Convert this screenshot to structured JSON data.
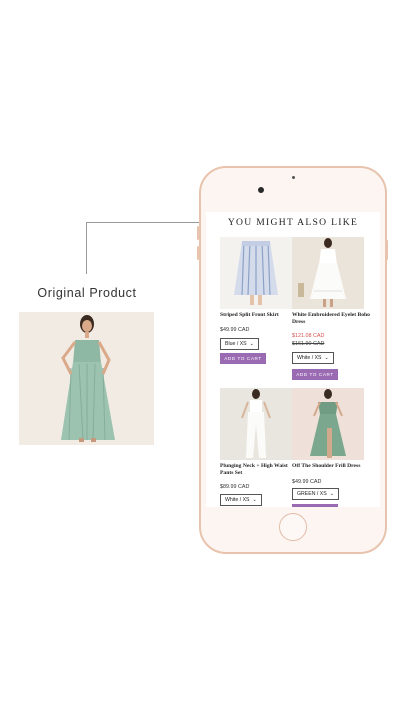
{
  "original": {
    "label": "Original Product"
  },
  "screen": {
    "title": "YOU MIGHT ALSO LIKE",
    "products": [
      {
        "name": "Striped Split Front Skirt",
        "price": "$49.99 CAD",
        "variant": "Blue / XS",
        "button": "ADD TO CART"
      },
      {
        "name": "White Embroidered Eyelet Boho Dress",
        "sale_price": "$121.08 CAD",
        "old_price": "$161.90 CAD",
        "variant": "White / XS",
        "button": "ADD TO CART"
      },
      {
        "name": "Plunging Neck + High Waist Pants Set",
        "price": "$89.99 CAD",
        "variant": "White / XS"
      },
      {
        "name": "Off The Shoulder Frill Dress",
        "price": "$49.99 CAD",
        "variant": "GREEN / XS"
      }
    ]
  },
  "icons": {
    "chevron": "chevron-down-icon"
  }
}
